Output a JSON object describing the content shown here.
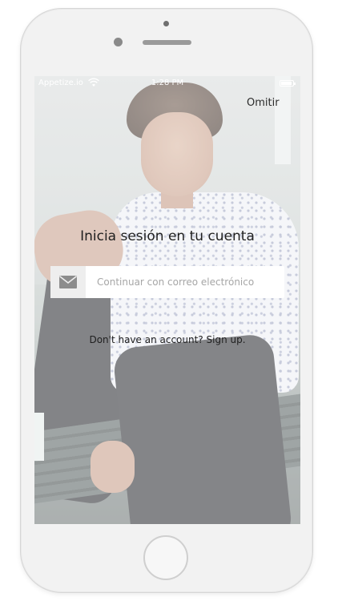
{
  "status_bar": {
    "carrier": "Appetize.io",
    "time": "1:28 PM"
  },
  "header": {
    "skip_label": "Omitir"
  },
  "login": {
    "title": "Inicia sesión en tu cuenta",
    "email_button_label": "Continuar con correo electrónico",
    "signup_prompt": "Don't have an account? Sign up."
  },
  "icons": {
    "wifi": "wifi-icon",
    "battery": "battery-icon",
    "email": "envelope-icon"
  },
  "colors": {
    "email_icon": "#8c8c8c",
    "text_dark": "#1f1f1f",
    "placeholder": "#a6a6a6"
  }
}
